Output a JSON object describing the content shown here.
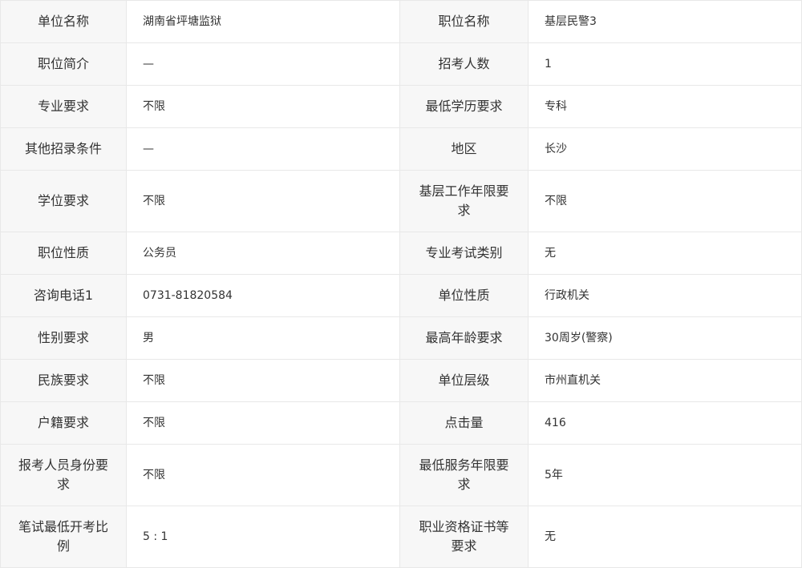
{
  "rows": [
    {
      "l1": "单位名称",
      "v1": "湖南省坪塘监狱",
      "l2": "职位名称",
      "v2": "基层民警3"
    },
    {
      "l1": "职位简介",
      "v1": "—",
      "l2": "招考人数",
      "v2": "1"
    },
    {
      "l1": "专业要求",
      "v1": "不限",
      "l2": "最低学历要求",
      "v2": "专科"
    },
    {
      "l1": "其他招录条件",
      "v1": "—",
      "l2": "地区",
      "v2": "长沙"
    },
    {
      "l1": "学位要求",
      "v1": "不限",
      "l2": "基层工作年限要求",
      "v2": "不限"
    },
    {
      "l1": "职位性质",
      "v1": "公务员",
      "l2": "专业考试类别",
      "v2": "无"
    },
    {
      "l1": "咨询电话1",
      "v1": "0731-81820584",
      "l2": "单位性质",
      "v2": "行政机关"
    },
    {
      "l1": "性别要求",
      "v1": "男",
      "l2": "最高年龄要求",
      "v2": "30周岁(警察)"
    },
    {
      "l1": "民族要求",
      "v1": "不限",
      "l2": "单位层级",
      "v2": "市州直机关"
    },
    {
      "l1": "户籍要求",
      "v1": "不限",
      "l2": "点击量",
      "v2": "416"
    },
    {
      "l1": "报考人员身份要求",
      "v1": "不限",
      "l2": "最低服务年限要求",
      "v2": "5年"
    },
    {
      "l1": "笔试最低开考比例",
      "v1": "5 : 1",
      "l2": "职业资格证书等要求",
      "v2": "无"
    }
  ]
}
